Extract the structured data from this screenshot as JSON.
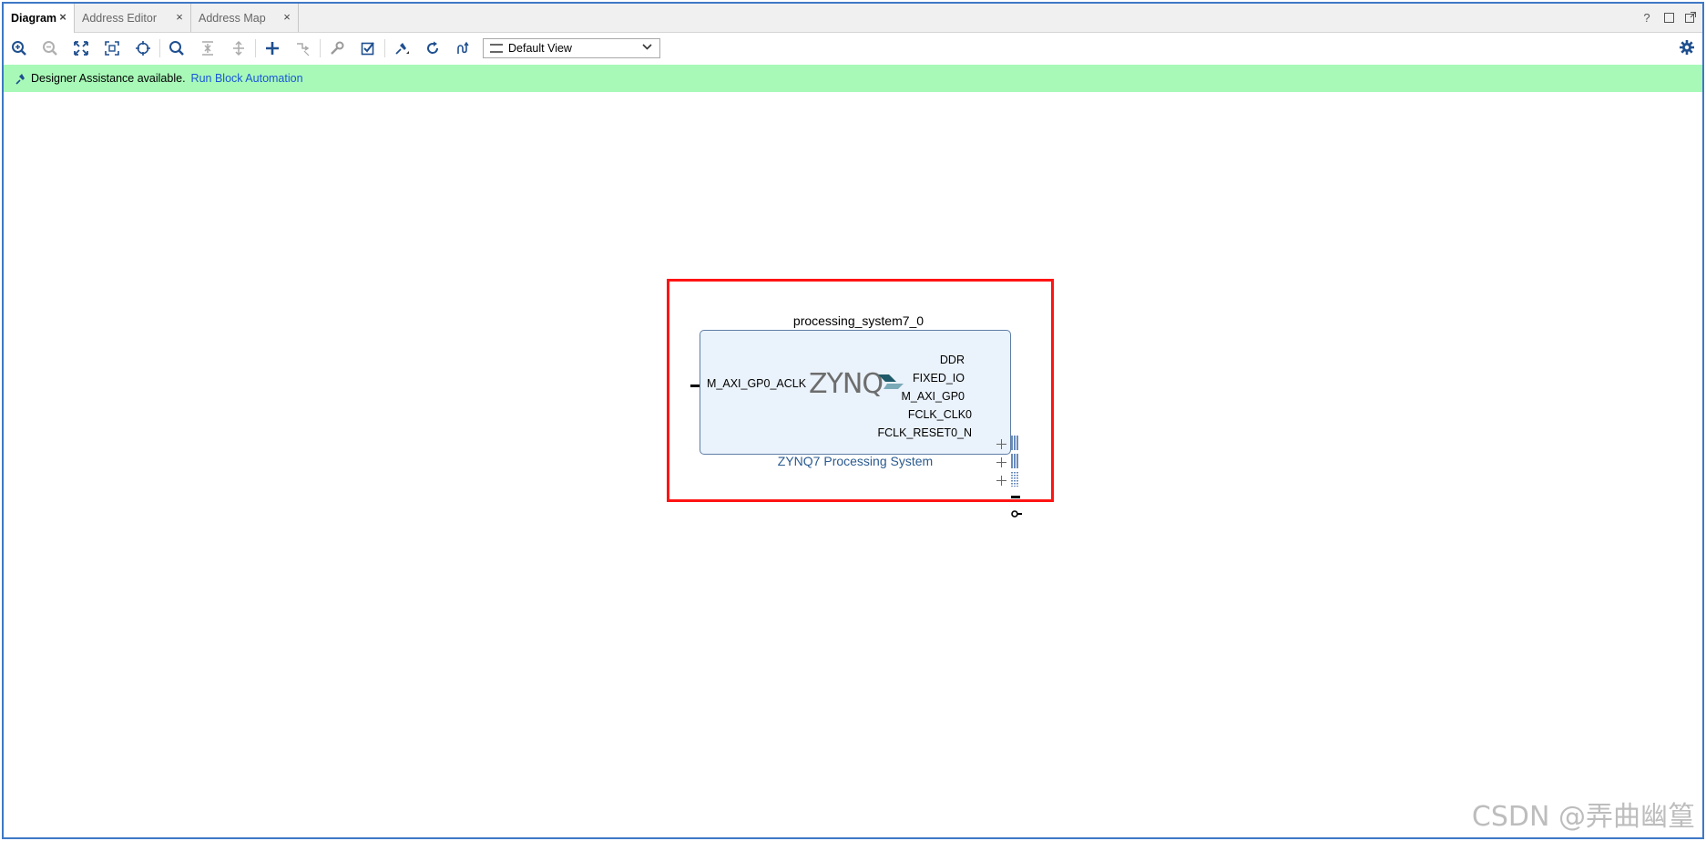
{
  "tabs": [
    {
      "label": "Diagram",
      "active": true
    },
    {
      "label": "Address Editor",
      "active": false
    },
    {
      "label": "Address Map",
      "active": false
    }
  ],
  "toolbar": {
    "buttons": [
      "zoom-in-icon",
      "zoom-out-icon",
      "fit-full-icon",
      "fit-selection-icon",
      "crosshair-icon",
      "search-icon",
      "collapse-all-icon",
      "expand-all-icon",
      "add-ip-icon",
      "make-connection-icon",
      "wrench-icon",
      "validate-icon",
      "pin-icon",
      "refresh-icon",
      "optimize-routing-icon"
    ],
    "view_selector": "Default View"
  },
  "banner": {
    "text": "Designer Assistance available.",
    "link": "Run Block Automation",
    "color": "#a8f9b8"
  },
  "diagram": {
    "instance_name": "processing_system7_0",
    "subtitle": "ZYNQ7 Processing System",
    "logo_text": "ZYNQ",
    "left_ports": [
      "M_AXI_GP0_ACLK"
    ],
    "right_ports": [
      "DDR",
      "FIXED_IO",
      "M_AXI_GP0",
      "FCLK_CLK0",
      "FCLK_RESET0_N"
    ],
    "highlight_color": "#ff1414"
  },
  "watermark": "CSDN @弄曲幽篁"
}
